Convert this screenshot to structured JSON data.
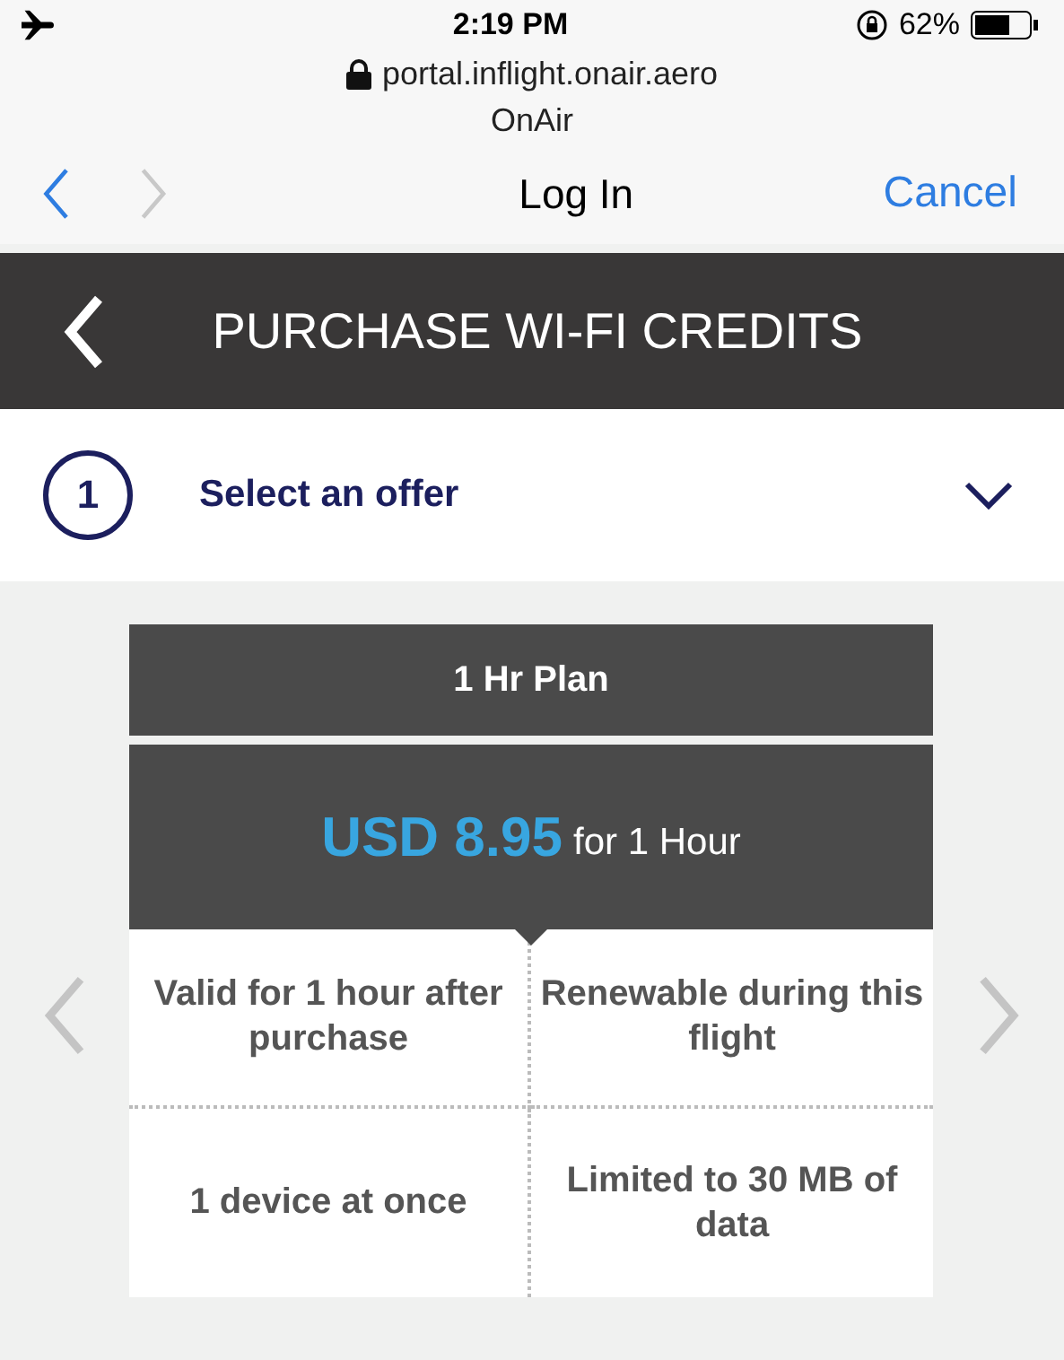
{
  "status_bar": {
    "time": "2:19 PM",
    "battery": "62%"
  },
  "browser": {
    "url": "portal.inflight.onair.aero",
    "site": "OnAir",
    "title": "Log In",
    "cancel": "Cancel",
    "nav": [
      {
        "kind": "back",
        "disabled": false
      },
      {
        "kind": "forward",
        "disabled": true
      }
    ]
  },
  "header": {
    "title": "PURCHASE WI-FI CREDITS"
  },
  "step": {
    "number": "1",
    "label": "Select an offer"
  },
  "offer": {
    "plan": "1 Hr Plan",
    "price": "USD 8.95",
    "duration": "for 1 Hour",
    "features": [
      "Valid for 1 hour after purchase",
      "Renewable during this flight",
      "1 device at once",
      "Limited to 30 MB of data"
    ]
  }
}
